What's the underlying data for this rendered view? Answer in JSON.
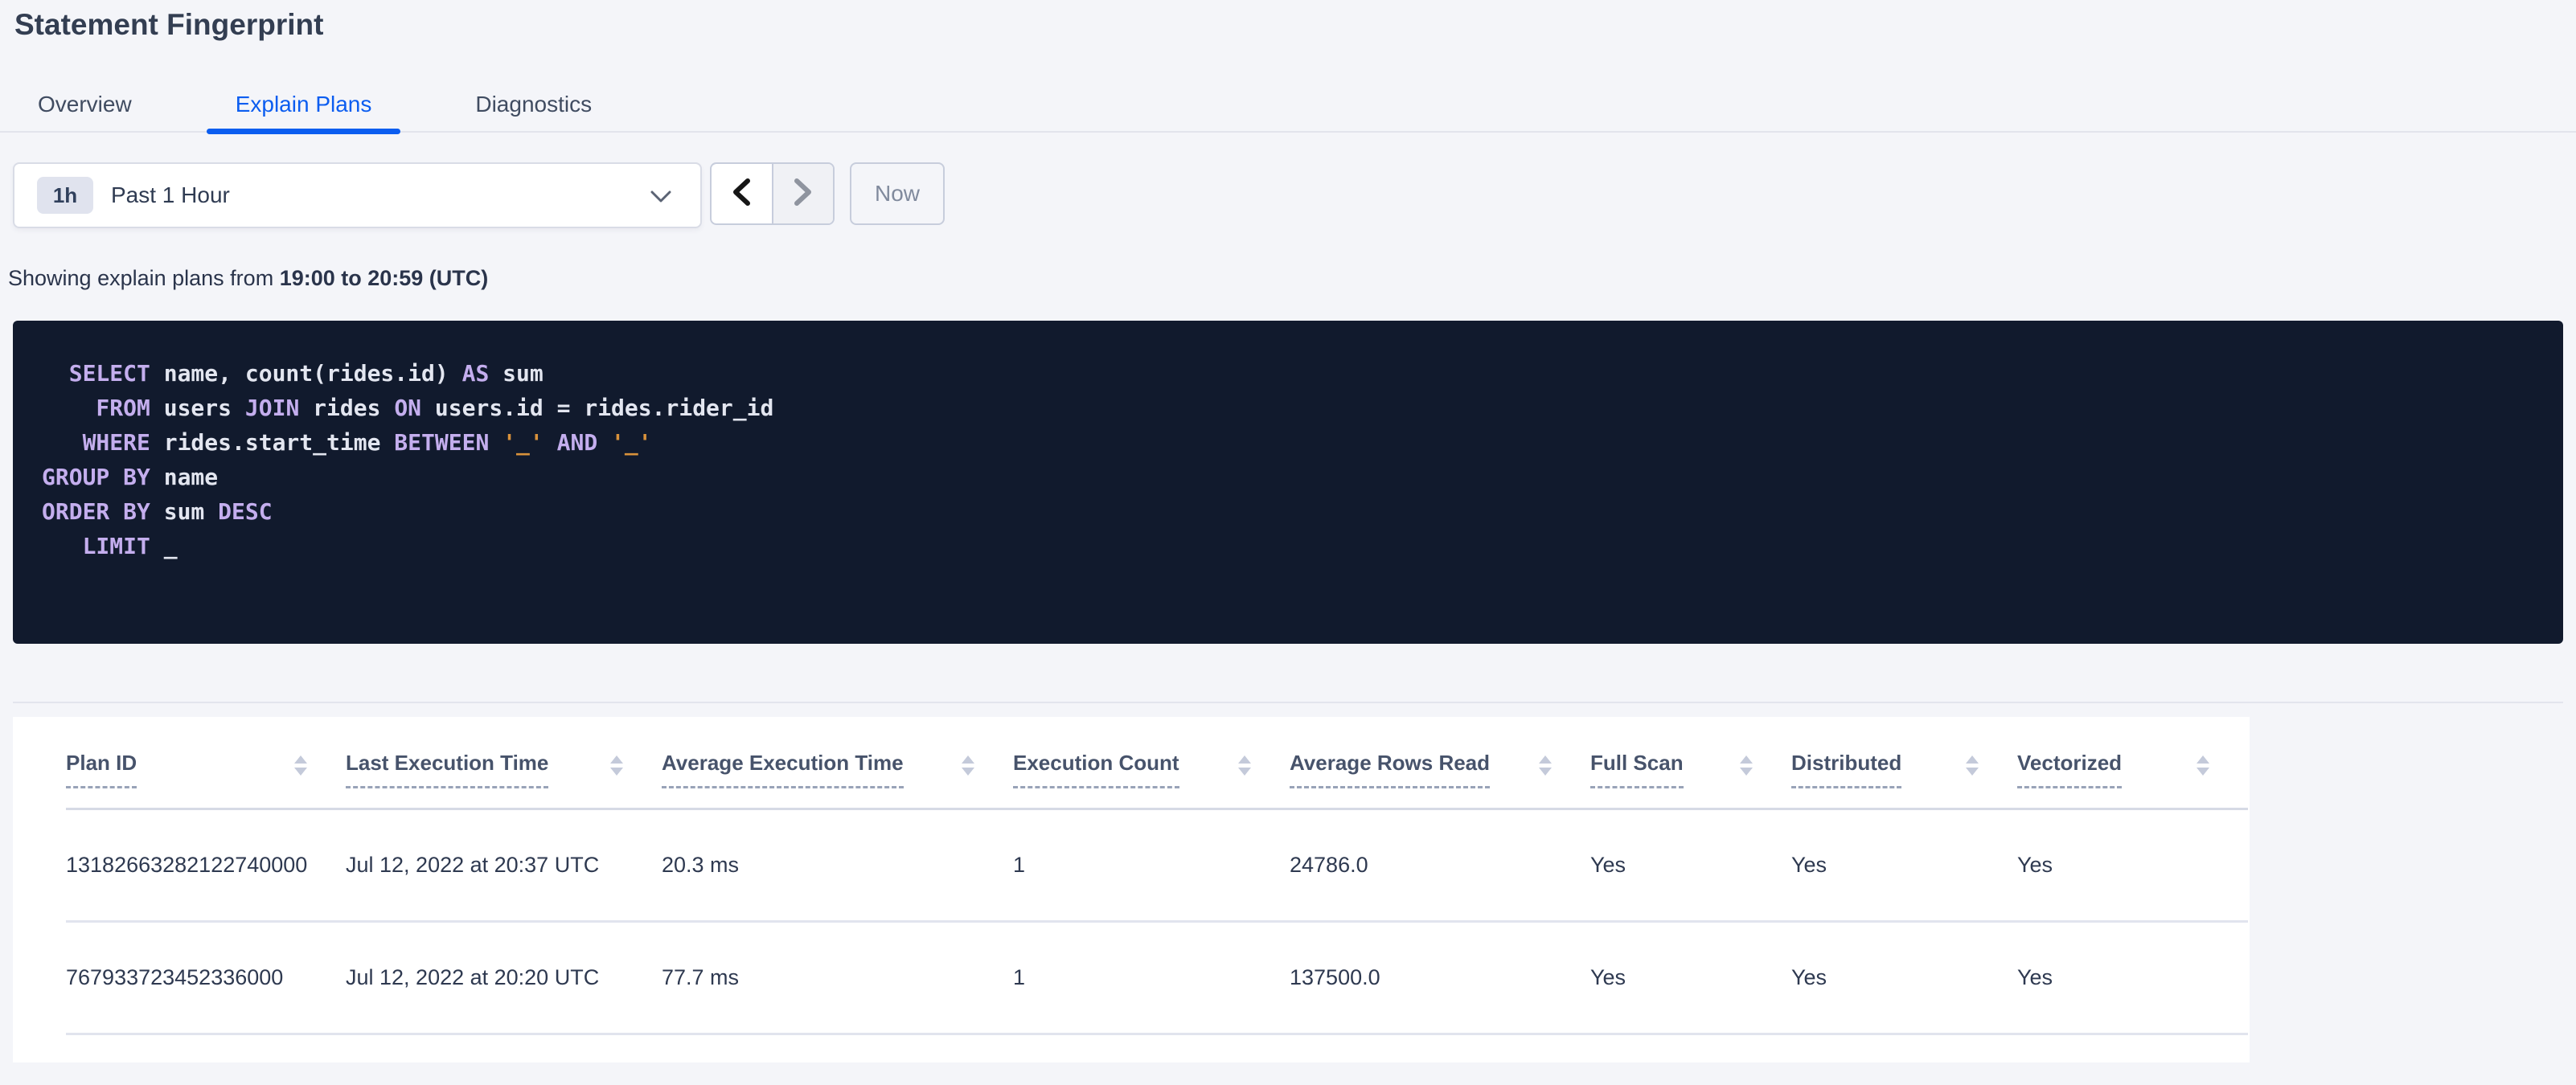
{
  "page": {
    "title": "Statement Fingerprint"
  },
  "tabs": [
    {
      "label": "Overview",
      "active": false
    },
    {
      "label": "Explain Plans",
      "active": true
    },
    {
      "label": "Diagnostics",
      "active": false
    }
  ],
  "time_picker": {
    "badge": "1h",
    "selected_option": "Past 1 Hour",
    "now_label": "Now"
  },
  "showing": {
    "prefix": "Showing explain plans from ",
    "range_bold": "19:00 to 20:59 (UTC)"
  },
  "sql": {
    "lines": [
      [
        [
          "kw",
          "  SELECT"
        ],
        [
          "pl",
          " name, count(rides.id) "
        ],
        [
          "kw",
          "AS"
        ],
        [
          "pl",
          " sum"
        ]
      ],
      [
        [
          "kw",
          "    FROM"
        ],
        [
          "pl",
          " users "
        ],
        [
          "kw",
          "JOIN"
        ],
        [
          "pl",
          " rides "
        ],
        [
          "kw",
          "ON"
        ],
        [
          "pl",
          " users.id = rides.rider_id"
        ]
      ],
      [
        [
          "kw",
          "   WHERE"
        ],
        [
          "pl",
          " rides.start_time "
        ],
        [
          "kw",
          "BETWEEN"
        ],
        [
          "pl",
          " "
        ],
        [
          "lit",
          "'_'"
        ],
        [
          "pl",
          " "
        ],
        [
          "kw",
          "AND"
        ],
        [
          "pl",
          " "
        ],
        [
          "lit",
          "'_'"
        ]
      ],
      [
        [
          "kw",
          "GROUP BY"
        ],
        [
          "pl",
          " name"
        ]
      ],
      [
        [
          "kw",
          "ORDER BY"
        ],
        [
          "pl",
          " sum "
        ],
        [
          "kw",
          "DESC"
        ]
      ],
      [
        [
          "kw",
          "   LIMIT"
        ],
        [
          "pl",
          " _"
        ]
      ]
    ]
  },
  "table": {
    "columns": [
      "Plan ID",
      "Last Execution Time",
      "Average Execution Time",
      "Execution Count",
      "Average Rows Read",
      "Full Scan",
      "Distributed",
      "Vectorized"
    ],
    "rows": [
      [
        "13182663282122740000",
        "Jul 12, 2022 at 20:37 UTC",
        "20.3 ms",
        "1",
        "24786.0",
        "Yes",
        "Yes",
        "Yes"
      ],
      [
        "767933723452336000",
        "Jul 12, 2022 at 20:20 UTC",
        "77.7 ms",
        "1",
        "137500.0",
        "Yes",
        "Yes",
        "Yes"
      ]
    ]
  },
  "colors": {
    "accent_blue": "#0b5df0",
    "page_background": "#f4f5f9",
    "code_background": "#111a2d",
    "code_keyword": "#c4aeee",
    "code_plain": "#e3e6f0",
    "code_literal": "#d9923b"
  },
  "icons": {
    "dropdown_caret": "chevron-down",
    "prev": "chevron-left",
    "next": "chevron-right",
    "sort": "sort-arrows"
  }
}
